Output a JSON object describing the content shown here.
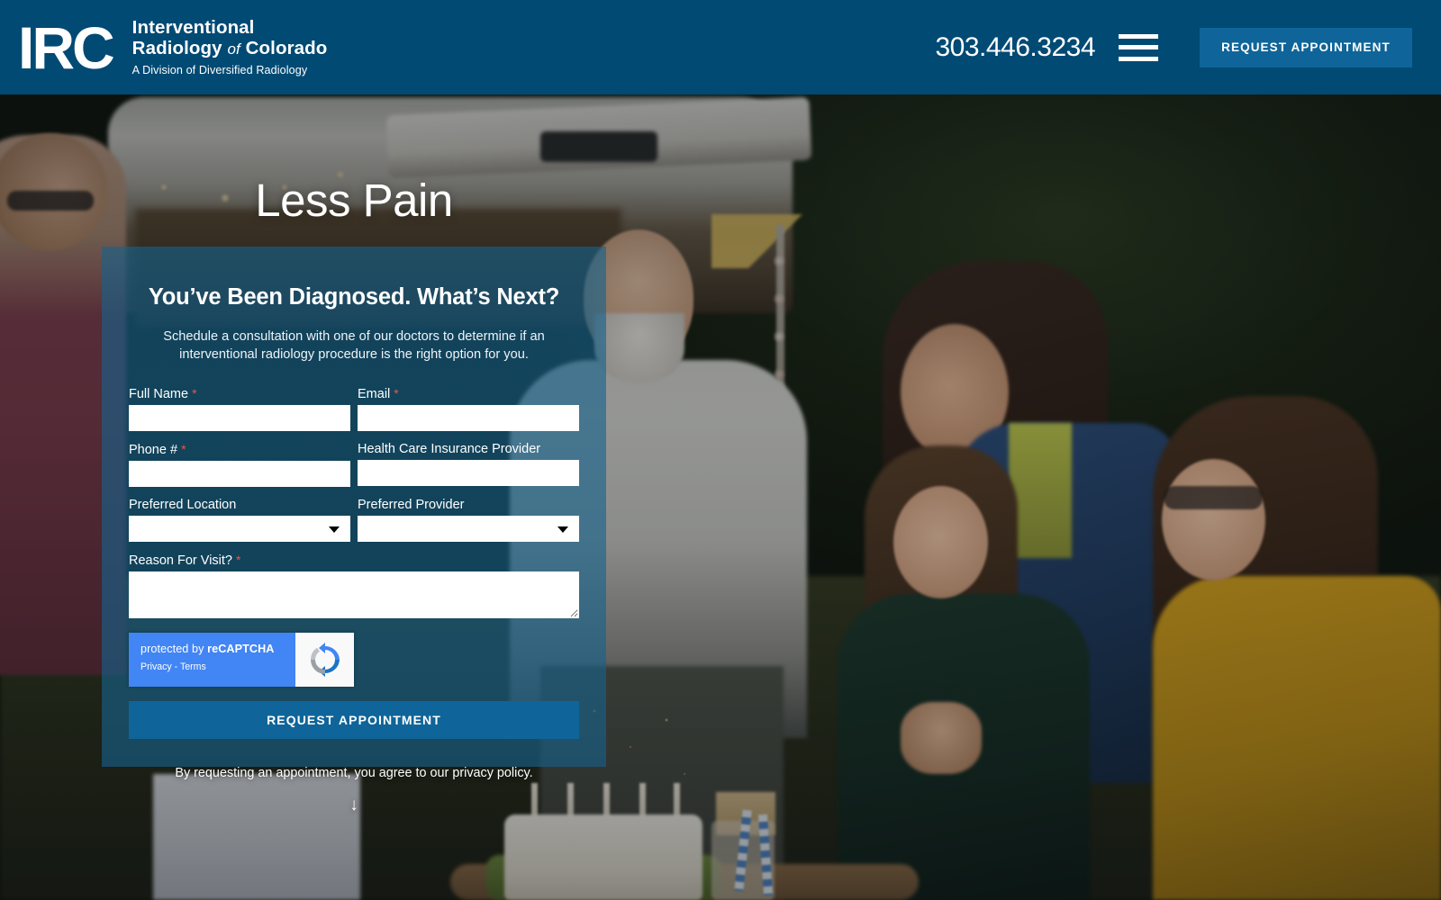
{
  "header": {
    "logo_mark": "IRC",
    "logo_line1": "Interventional",
    "logo_line2_a": "Radiology",
    "logo_line2_of": "of",
    "logo_line2_b": "Colorado",
    "logo_tagline": "A Division of Diversified Radiology",
    "phone": "303.446.3234",
    "menu_icon": "hamburger-menu-icon",
    "appointment_button": "REQUEST APPOINTMENT",
    "bg_color": "#004A74",
    "button_color": "#0F6599"
  },
  "hero": {
    "heading": "Less Pain"
  },
  "form": {
    "title": "You’ve Been Diagnosed. What’s Next?",
    "subtitle": "Schedule a consultation with one of our doctors to determine if an interventional radiology procedure is the right option for you.",
    "panel_color": "#17628C",
    "required_marker": "*",
    "fields": [
      {
        "label": "Full Name",
        "required": true,
        "type": "text",
        "value": ""
      },
      {
        "label": "Email",
        "required": true,
        "type": "text",
        "value": ""
      },
      {
        "label": "Phone #",
        "required": true,
        "type": "text",
        "value": ""
      },
      {
        "label": "Health Care Insurance Provider",
        "required": false,
        "type": "text",
        "value": ""
      },
      {
        "label": "Preferred Location",
        "required": false,
        "type": "select",
        "value": ""
      },
      {
        "label": "Preferred Provider",
        "required": false,
        "type": "select",
        "value": ""
      },
      {
        "label": "Reason For Visit?",
        "required": true,
        "type": "textarea",
        "value": ""
      }
    ],
    "recaptcha": {
      "line1_prefix": "protected by ",
      "line1_brand": "reCAPTCHA",
      "line2": "Privacy - Terms",
      "icon": "recaptcha-logo-icon",
      "bg_color": "#4285F4"
    },
    "submit_button": "REQUEST APPOINTMENT"
  },
  "footer": {
    "privacy_note": "By requesting an appointment, you agree to our privacy policy.",
    "scroll_indicator": "↓"
  }
}
